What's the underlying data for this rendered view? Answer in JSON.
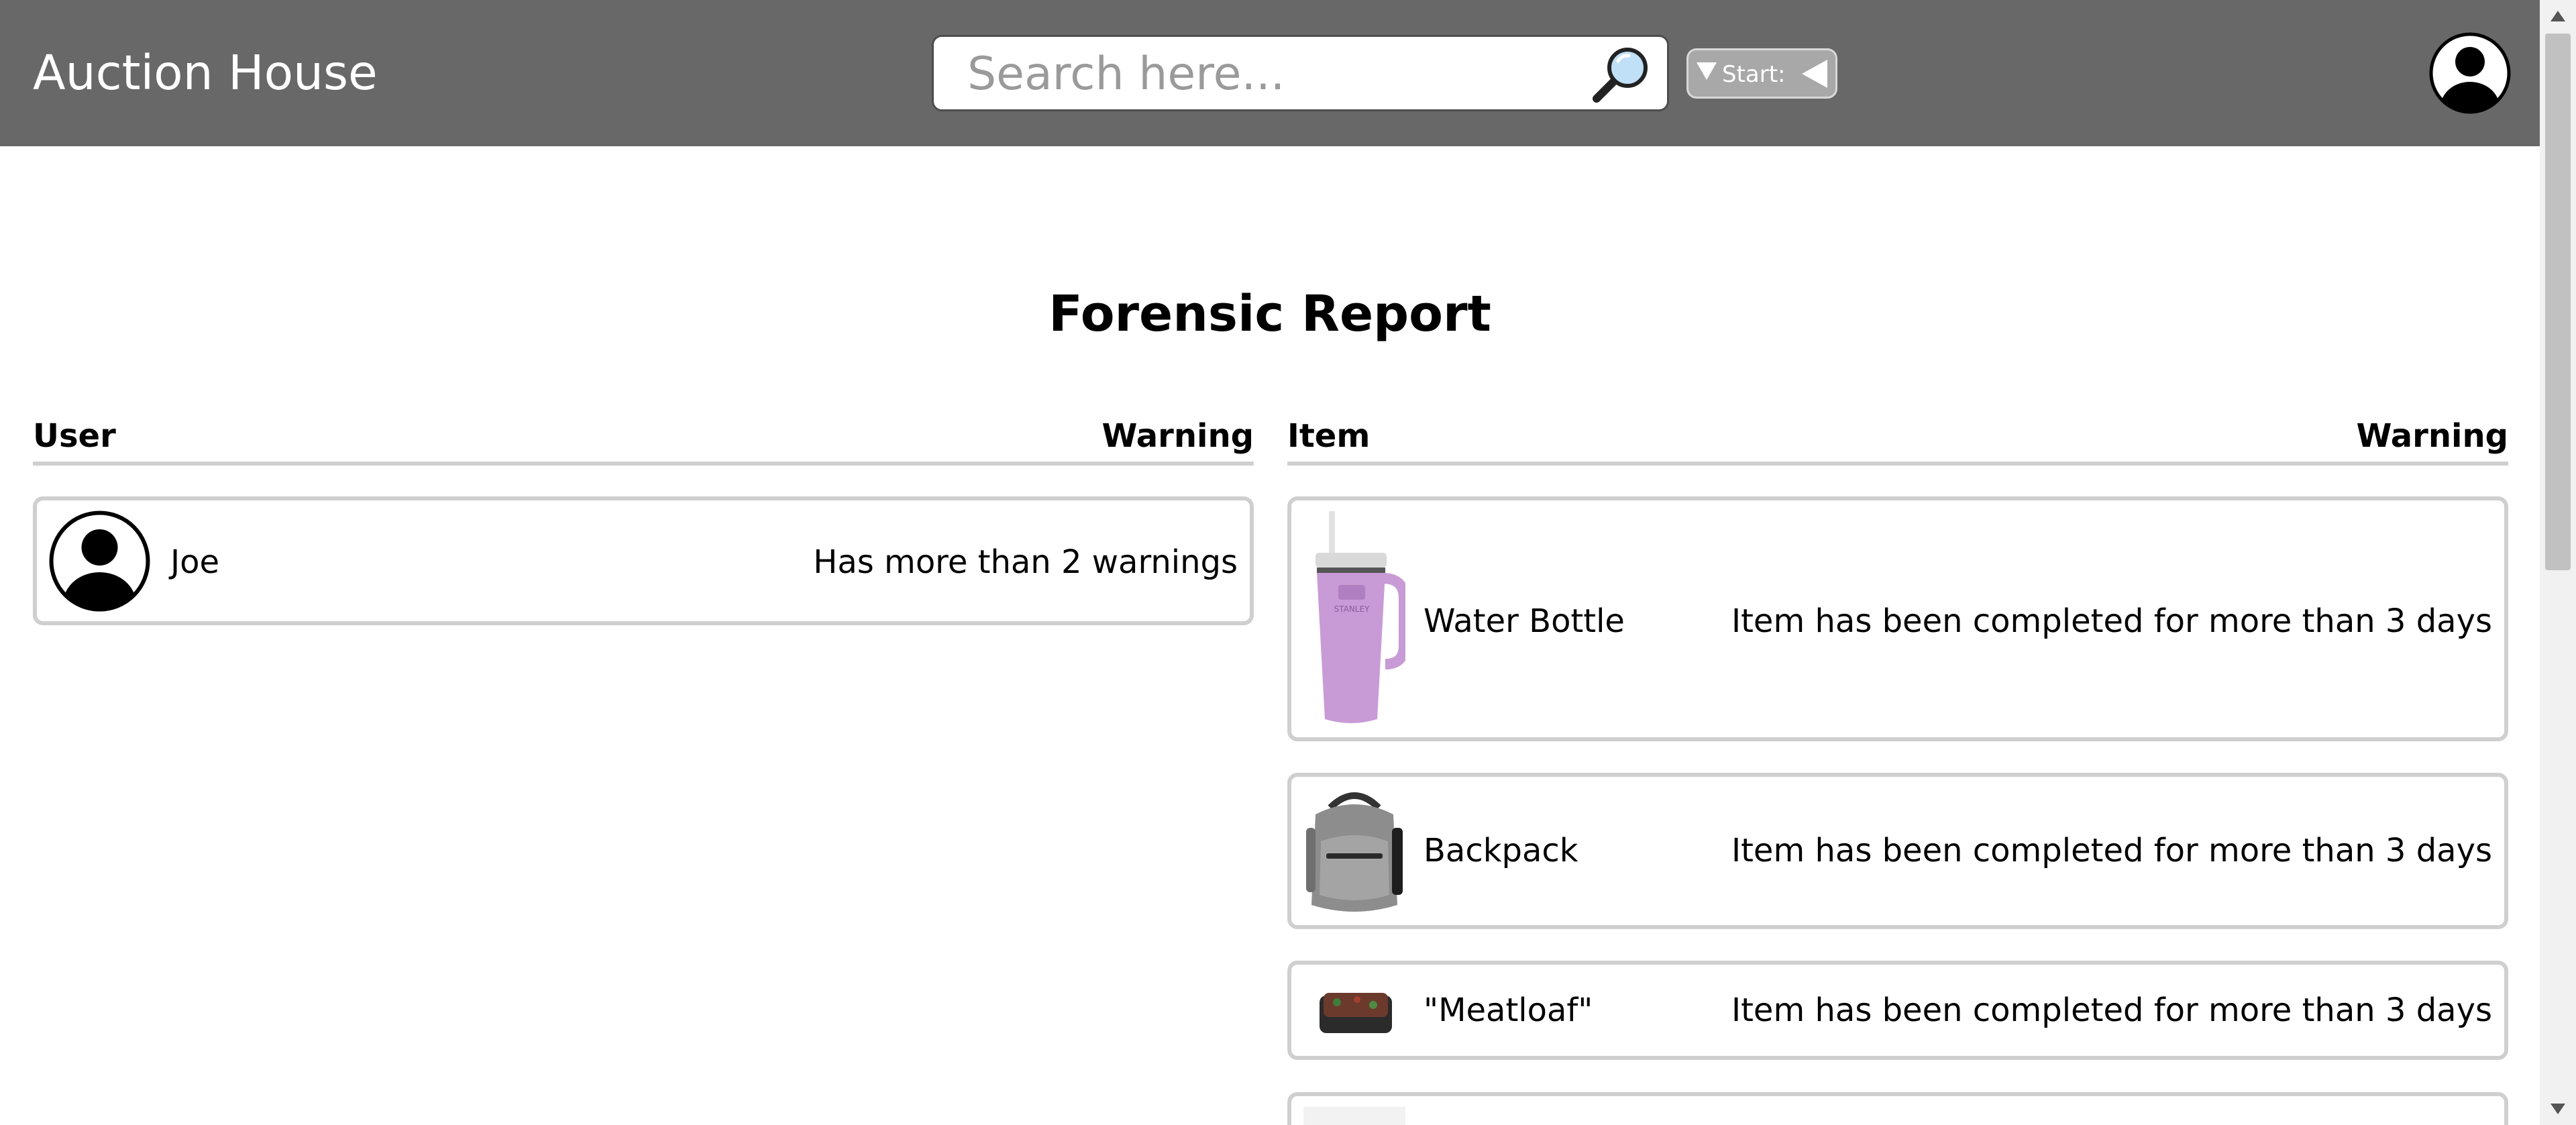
{
  "header": {
    "app_title": "Auction House",
    "search_placeholder": "Search here...",
    "start_label": "Start:"
  },
  "page_title": "Forensic Report",
  "users_table": {
    "headers": {
      "user": "User",
      "warning": "Warning"
    },
    "rows": [
      {
        "name": "Joe",
        "warning": "Has more than 2 warnings",
        "icon": "user-avatar-icon"
      }
    ]
  },
  "items_table": {
    "headers": {
      "item": "Item",
      "warning": "Warning"
    },
    "rows": [
      {
        "name": "Water Bottle",
        "warning": "Item has been completed for more than 3 days",
        "image": "purple-tumbler",
        "brand_mark": "STANLEY"
      },
      {
        "name": "Backpack",
        "warning": "Item has been completed for more than 3 days",
        "image": "grey-backpack"
      },
      {
        "name": "\"Meatloaf\"",
        "warning": "Item has been completed for more than 3 days",
        "image": "meatloaf-tray"
      }
    ]
  },
  "colors": {
    "header_bg": "#686868",
    "header_text": "#ffffff",
    "card_border": "#cfcfcf",
    "start_button_bg": "#a8a8a8",
    "tumbler": "#c89bd6"
  }
}
